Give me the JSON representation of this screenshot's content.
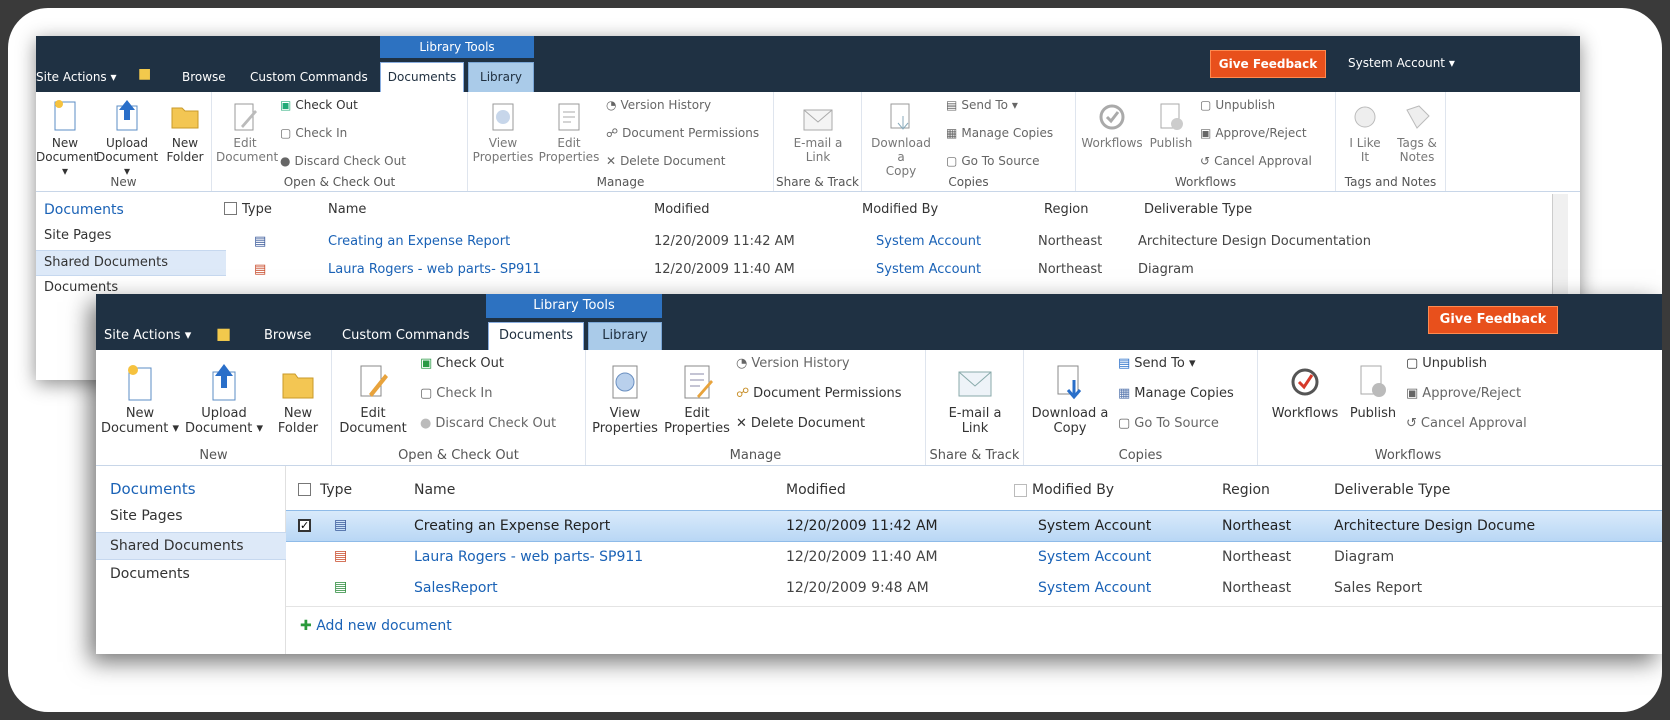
{
  "top": {
    "site_actions": "Site Actions ▾",
    "browse": "Browse",
    "custom_commands": "Custom Commands",
    "library_tools": "Library Tools",
    "tab_documents": "Documents",
    "tab_library": "Library",
    "give_feedback": "Give Feedback",
    "account": "System Account ▾"
  },
  "ribbon": {
    "new_document": [
      "New",
      "Document ▾"
    ],
    "upload_document": [
      "Upload",
      "Document ▾"
    ],
    "new_folder": [
      "New",
      "Folder"
    ],
    "group_new": "New",
    "edit_document": [
      "Edit",
      "Document"
    ],
    "check_out": "Check Out",
    "check_in": "Check In",
    "discard_check_out": "Discard Check Out",
    "group_open": "Open & Check Out",
    "view_properties": [
      "View",
      "Properties"
    ],
    "edit_properties": [
      "Edit",
      "Properties"
    ],
    "version_history": "Version History",
    "document_permissions": "Document Permissions",
    "delete_document": "Delete Document",
    "group_manage": "Manage",
    "email_link": [
      "E-mail a",
      "Link"
    ],
    "group_share": "Share & Track",
    "download_copy": [
      "Download a",
      "Copy"
    ],
    "send_to": "Send To ▾",
    "manage_copies": "Manage Copies",
    "go_to_source": "Go To Source",
    "group_copies": "Copies",
    "workflows": "Workflows",
    "publish": "Publish",
    "unpublish": "Unpublish",
    "approve_reject": "Approve/Reject",
    "cancel_approval": "Cancel Approval",
    "group_workflows": "Workflows",
    "i_like_it": [
      "I Like",
      "It"
    ],
    "tags_notes": [
      "Tags &",
      "Notes"
    ],
    "group_tags": "Tags and Notes"
  },
  "nav": {
    "heading": "Documents",
    "site_pages": "Site Pages",
    "shared_documents": "Shared Documents",
    "documents": "Documents"
  },
  "columns": {
    "type": "Type",
    "name": "Name",
    "modified": "Modified",
    "modified_by": "Modified By",
    "region": "Region",
    "deliverable_type": "Deliverable Type"
  },
  "rows": [
    {
      "name": "Creating an Expense Report",
      "modified": "12/20/2009 11:42 AM",
      "modified_by": "System Account",
      "region": "Northeast",
      "deliverable": "Architecture Design Documentation",
      "deliverable_short": "Architecture Design Docume",
      "icon": "word-icon"
    },
    {
      "name": "Laura Rogers - web parts- SP911",
      "modified": "12/20/2009 11:40 AM",
      "modified_by": "System Account",
      "region": "Northeast",
      "deliverable": "Diagram",
      "icon": "powerpoint-icon"
    },
    {
      "name": "SalesReport",
      "modified": "12/20/2009 9:48 AM",
      "modified_by": "System Account",
      "region": "Northeast",
      "deliverable": "Sales Report",
      "icon": "excel-icon"
    }
  ],
  "add_new_document": "Add new document",
  "colors": {
    "topbar": "#1f3143",
    "library_tools": "#2d72c1",
    "feedback": "#e8501c",
    "link": "#1a62b6"
  }
}
